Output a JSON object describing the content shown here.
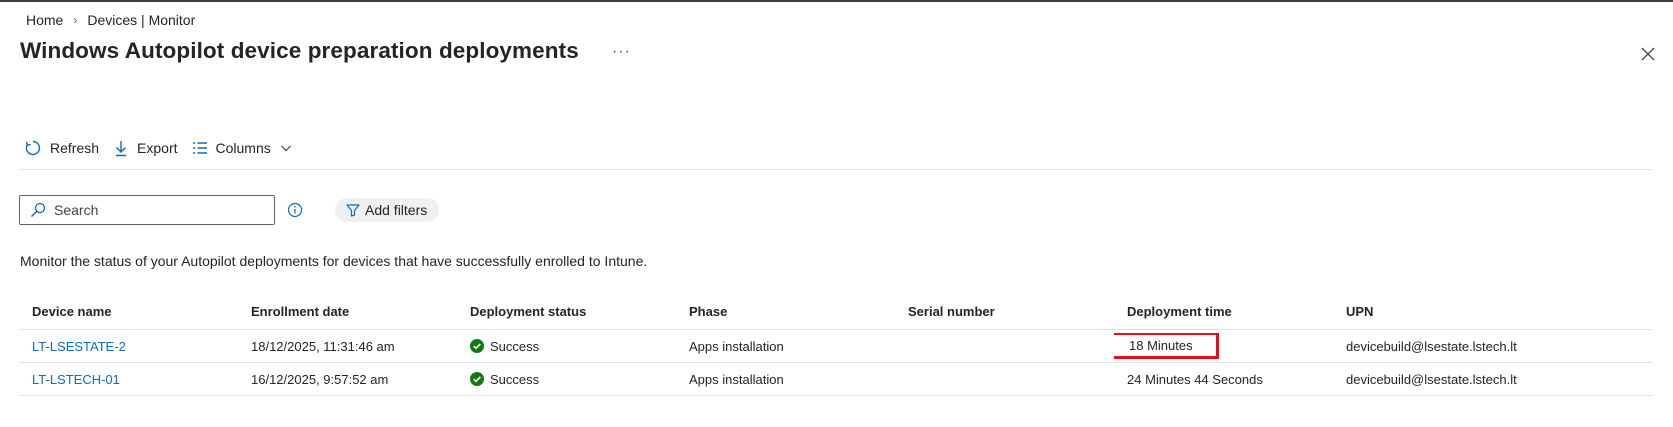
{
  "breadcrumb": {
    "items": [
      "Home",
      "Devices | Monitor"
    ],
    "separator": "›"
  },
  "title": "Windows Autopilot device preparation deployments",
  "more_label": "···",
  "toolbar": {
    "refresh_label": "Refresh",
    "export_label": "Export",
    "columns_label": "Columns"
  },
  "search": {
    "placeholder": "Search"
  },
  "filters": {
    "add_label": "Add filters"
  },
  "description": "Monitor the status of your Autopilot deployments for devices that have successfully enrolled to Intune.",
  "table": {
    "headers": [
      "Device name",
      "Enrollment date",
      "Deployment status",
      "Phase",
      "Serial number",
      "Deployment time",
      "UPN"
    ],
    "rows": [
      {
        "device_name": "LT-LSESTATE-2",
        "enrollment_date": "18/12/2025, 11:31:46 am",
        "status": "Success",
        "phase": "Apps installation",
        "serial": "",
        "deployment_time": "18 Minutes",
        "upn": "devicebuild@lsestate.lstech.lt"
      },
      {
        "device_name": "LT-LSTECH-01",
        "enrollment_date": "16/12/2025, 9:57:52 am",
        "status": "Success",
        "phase": "Apps installation",
        "serial": "",
        "deployment_time": "24 Minutes 44 Seconds",
        "upn": "devicebuild@lsestate.lstech.lt"
      }
    ]
  },
  "colors": {
    "accent": "#0f6cbd",
    "success": "#107c10",
    "highlight": "#e3101b"
  }
}
